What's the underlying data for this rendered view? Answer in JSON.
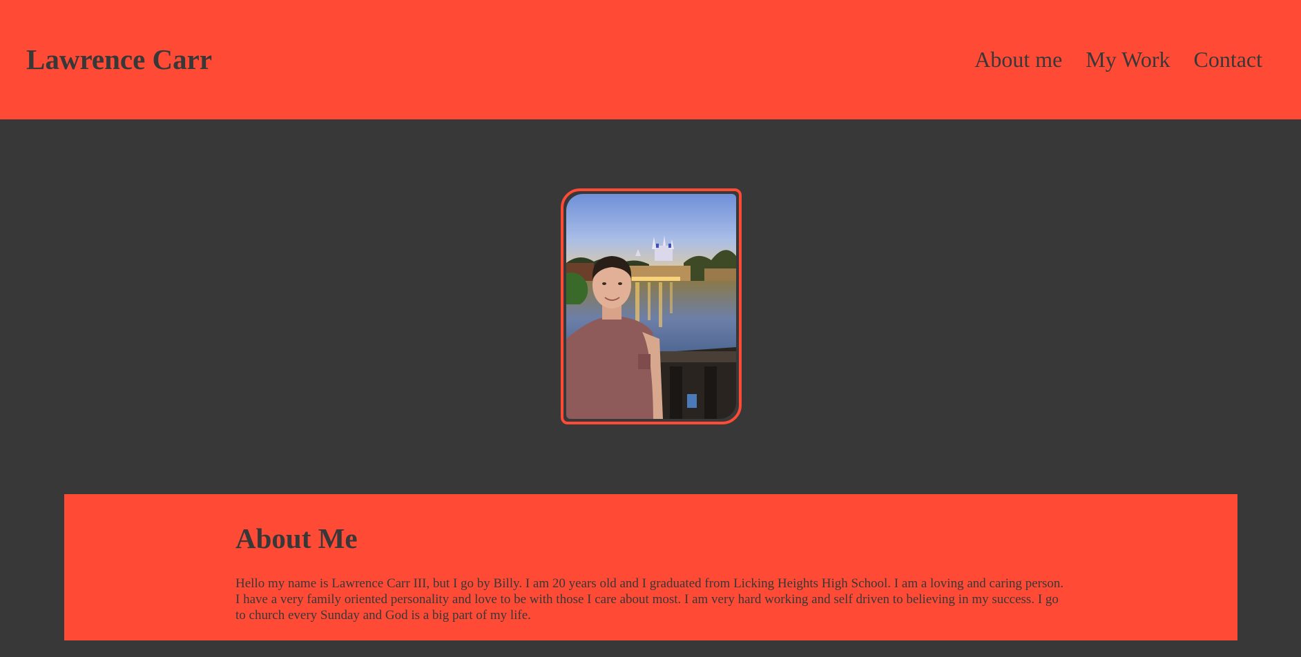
{
  "header": {
    "site_title": "Lawrence Carr",
    "nav": [
      {
        "label": "About me"
      },
      {
        "label": "My Work"
      },
      {
        "label": "Contact"
      }
    ]
  },
  "profile_photo": {
    "icon": "person-portrait-photo"
  },
  "about": {
    "heading": "About Me",
    "text": "Hello my name is Lawrence Carr III, but I go by Billy. I am 20 years old and I graduated from Licking Heights High School. I am a loving and caring person. I have a very family oriented personality and love to be with those I care about most. I am very hard working and self driven to believing in my success. I go to church every Sunday and God is a big part of my life."
  },
  "colors": {
    "accent": "#ff4a35",
    "background": "#383838",
    "text": "#383838"
  }
}
